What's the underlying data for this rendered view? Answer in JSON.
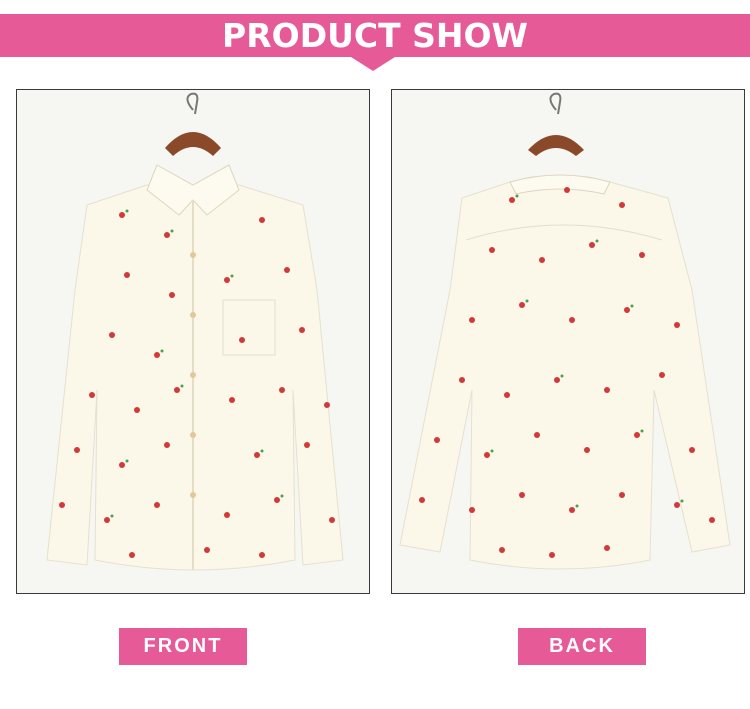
{
  "header": {
    "title": "PRODUCT SHOW"
  },
  "views": [
    {
      "label": "FRONT"
    },
    {
      "label": "BACK"
    }
  ],
  "colors": {
    "accent": "#e75a98",
    "shirt": "#fbf8ea",
    "cherry": "#d23a3a",
    "leaf": "#4aa14a"
  }
}
